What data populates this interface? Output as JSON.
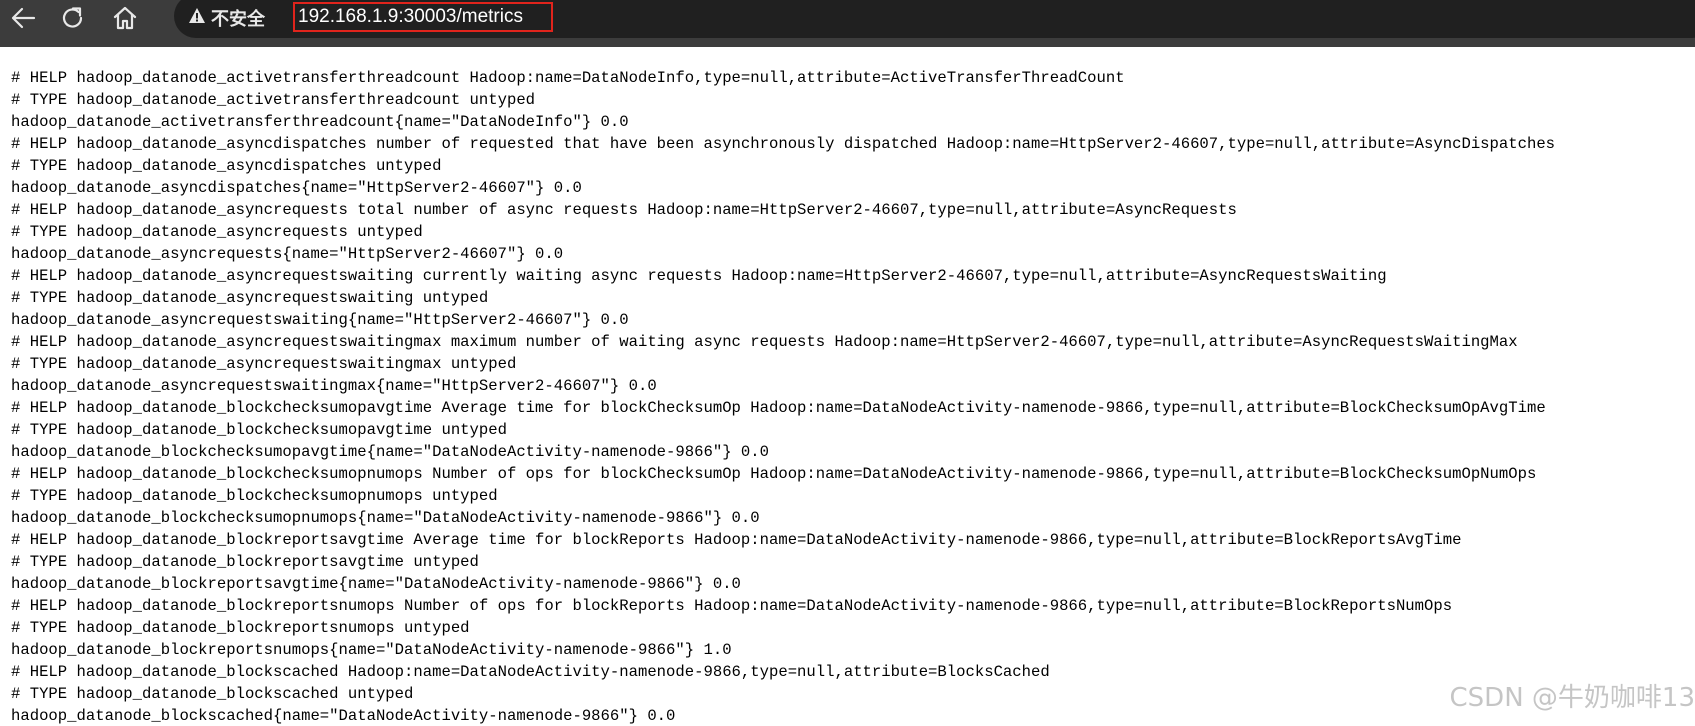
{
  "browser": {
    "security_label": "不安全",
    "url": "192.168.1.9:30003/metrics",
    "icons": {
      "back": "back-arrow-icon",
      "reload": "reload-icon",
      "home": "home-icon",
      "warning": "warning-triangle-icon"
    }
  },
  "metrics": {
    "lines": [
      "# HELP hadoop_datanode_activetransferthreadcount Hadoop:name=DataNodeInfo,type=null,attribute=ActiveTransferThreadCount",
      "# TYPE hadoop_datanode_activetransferthreadcount untyped",
      "hadoop_datanode_activetransferthreadcount{name=\"DataNodeInfo\"} 0.0",
      "# HELP hadoop_datanode_asyncdispatches number of requested that have been asynchronously dispatched Hadoop:name=HttpServer2-46607,type=null,attribute=AsyncDispatches",
      "# TYPE hadoop_datanode_asyncdispatches untyped",
      "hadoop_datanode_asyncdispatches{name=\"HttpServer2-46607\"} 0.0",
      "# HELP hadoop_datanode_asyncrequests total number of async requests Hadoop:name=HttpServer2-46607,type=null,attribute=AsyncRequests",
      "# TYPE hadoop_datanode_asyncrequests untyped",
      "hadoop_datanode_asyncrequests{name=\"HttpServer2-46607\"} 0.0",
      "# HELP hadoop_datanode_asyncrequestswaiting currently waiting async requests Hadoop:name=HttpServer2-46607,type=null,attribute=AsyncRequestsWaiting",
      "# TYPE hadoop_datanode_asyncrequestswaiting untyped",
      "hadoop_datanode_asyncrequestswaiting{name=\"HttpServer2-46607\"} 0.0",
      "# HELP hadoop_datanode_asyncrequestswaitingmax maximum number of waiting async requests Hadoop:name=HttpServer2-46607,type=null,attribute=AsyncRequestsWaitingMax",
      "# TYPE hadoop_datanode_asyncrequestswaitingmax untyped",
      "hadoop_datanode_asyncrequestswaitingmax{name=\"HttpServer2-46607\"} 0.0",
      "# HELP hadoop_datanode_blockchecksumopavgtime Average time for blockChecksumOp Hadoop:name=DataNodeActivity-namenode-9866,type=null,attribute=BlockChecksumOpAvgTime",
      "# TYPE hadoop_datanode_blockchecksumopavgtime untyped",
      "hadoop_datanode_blockchecksumopavgtime{name=\"DataNodeActivity-namenode-9866\"} 0.0",
      "# HELP hadoop_datanode_blockchecksumopnumops Number of ops for blockChecksumOp Hadoop:name=DataNodeActivity-namenode-9866,type=null,attribute=BlockChecksumOpNumOps",
      "# TYPE hadoop_datanode_blockchecksumopnumops untyped",
      "hadoop_datanode_blockchecksumopnumops{name=\"DataNodeActivity-namenode-9866\"} 0.0",
      "# HELP hadoop_datanode_blockreportsavgtime Average time for blockReports Hadoop:name=DataNodeActivity-namenode-9866,type=null,attribute=BlockReportsAvgTime",
      "# TYPE hadoop_datanode_blockreportsavgtime untyped",
      "hadoop_datanode_blockreportsavgtime{name=\"DataNodeActivity-namenode-9866\"} 0.0",
      "# HELP hadoop_datanode_blockreportsnumops Number of ops for blockReports Hadoop:name=DataNodeActivity-namenode-9866,type=null,attribute=BlockReportsNumOps",
      "# TYPE hadoop_datanode_blockreportsnumops untyped",
      "hadoop_datanode_blockreportsnumops{name=\"DataNodeActivity-namenode-9866\"} 1.0",
      "# HELP hadoop_datanode_blockscached Hadoop:name=DataNodeActivity-namenode-9866,type=null,attribute=BlocksCached",
      "# TYPE hadoop_datanode_blockscached untyped",
      "hadoop_datanode_blockscached{name=\"DataNodeActivity-namenode-9866\"} 0.0"
    ]
  },
  "watermark": "CSDN @牛奶咖啡13"
}
